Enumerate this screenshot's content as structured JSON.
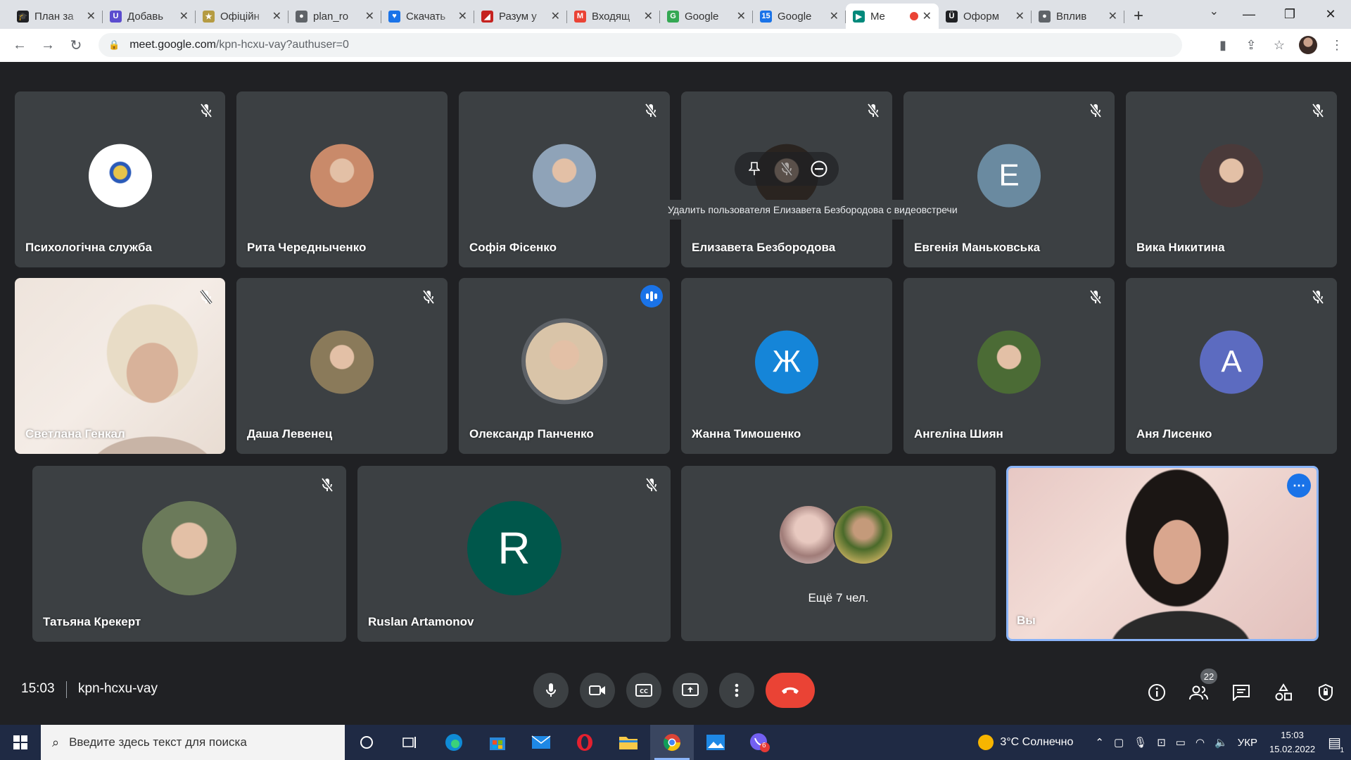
{
  "browser": {
    "tabs": [
      {
        "title": "План за",
        "color": "#202124",
        "glyph": "🎓"
      },
      {
        "title": "Добавь",
        "color": "#5b4ccf",
        "glyph": "U"
      },
      {
        "title": "Офіційн",
        "color": "#b59b42",
        "glyph": "★"
      },
      {
        "title": "plan_ro",
        "color": "#5f6368",
        "glyph": "●"
      },
      {
        "title": "Скачать",
        "color": "#1a73e8",
        "glyph": "♥"
      },
      {
        "title": "Разум у",
        "color": "#c5221f",
        "glyph": "◢"
      },
      {
        "title": "Входящ",
        "color": "#ea4335",
        "glyph": "M"
      },
      {
        "title": "Google",
        "color": "#34a853",
        "glyph": "G"
      },
      {
        "title": "Google",
        "color": "#1a73e8",
        "glyph": "15"
      },
      {
        "title": "Me",
        "color": "#00897b",
        "glyph": "▶",
        "active": true
      },
      {
        "title": "Оформ",
        "color": "#202124",
        "glyph": "Ü"
      },
      {
        "title": "Вплив",
        "color": "#5f6368",
        "glyph": "●"
      }
    ],
    "url_host": "meet.google.com",
    "url_path": "/kpn-hcxu-vay?authuser=0"
  },
  "meet": {
    "tooltip": "Удалить пользователя Елизавета Безбородова с видеовстречи",
    "participants": [
      {
        "name": "Психологічна служба",
        "avatar_color": "#ffffff",
        "initial": "",
        "muted": true
      },
      {
        "name": "Рита Чередныченко",
        "avatar_color": "#c98a6a",
        "initial": "",
        "muted": false
      },
      {
        "name": "Софія Фісенко",
        "avatar_color": "#8fa3b8",
        "initial": "",
        "muted": true
      },
      {
        "name": "Елизавета Безбородова",
        "avatar_color": "#2a2420",
        "initial": "",
        "muted": true
      },
      {
        "name": "Евгенія Маньковська",
        "avatar_color": "#6a8aa0",
        "initial": "E",
        "muted": true
      },
      {
        "name": "Вика Никитина",
        "avatar_color": "#4a3a3a",
        "initial": "",
        "muted": true
      },
      {
        "name": "Светлана Генкал",
        "avatar_color": "",
        "initial": "",
        "muted": true
      },
      {
        "name": "Даша Левенец",
        "avatar_color": "#8a7a5a",
        "initial": "",
        "muted": true
      },
      {
        "name": "Олександр Панченко",
        "avatar_color": "#d9c4a8",
        "initial": "",
        "muted": false
      },
      {
        "name": "Жанна Тимошенко",
        "avatar_color": "#1585d8",
        "initial": "Ж",
        "muted": false
      },
      {
        "name": "Ангеліна Шиян",
        "avatar_color": "#4b6b35",
        "initial": "",
        "muted": true
      },
      {
        "name": "Аня Лисенко",
        "avatar_color": "#5c6bc0",
        "initial": "A",
        "muted": true
      },
      {
        "name": "Татьяна Крекерт",
        "avatar_color": "#6b7a5a",
        "initial": "",
        "muted": true
      },
      {
        "name": "Ruslan Artamonov",
        "avatar_color": "#00574b",
        "initial": "R",
        "muted": true
      }
    ],
    "more_label": "Ещё 7 чел.",
    "self_label": "Вы",
    "time": "15:03",
    "meeting_code": "kpn-hcxu-vay",
    "people_count": "22"
  },
  "taskbar": {
    "search_placeholder": "Введите здесь текст для поиска",
    "weather": "3°C  Солнечно",
    "lang": "УКР",
    "clock_time": "15:03",
    "clock_date": "15.02.2022",
    "notif_count": "1",
    "viber_badge": "6"
  }
}
